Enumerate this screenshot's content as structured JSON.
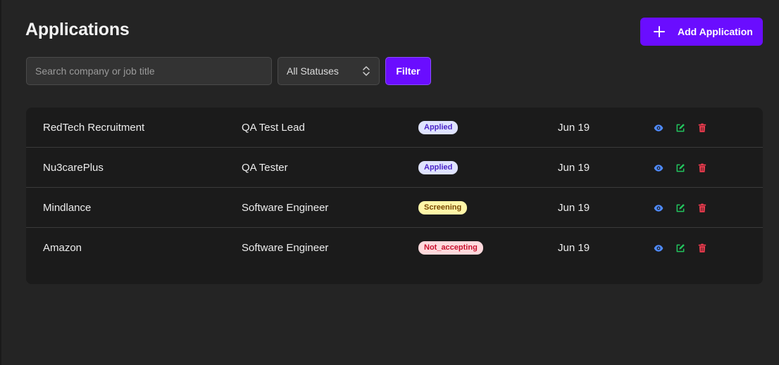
{
  "header": {
    "title": "Applications",
    "add_button_label": "Add Application"
  },
  "filters": {
    "search_placeholder": "Search company or job title",
    "search_value": "",
    "status_selected": "All Statuses",
    "filter_button_label": "Filter"
  },
  "colors": {
    "accent": "#6a0dff",
    "view_icon": "#4f8bff",
    "edit_icon": "#22c55e",
    "delete_icon": "#ef3b4e"
  },
  "badge_styles": {
    "Applied": {
      "bg": "#dfe3ff",
      "fg": "#4b25c8"
    },
    "Screening": {
      "bg": "#fff6a8",
      "fg": "#7a4a00"
    },
    "Not_accepting": {
      "bg": "#ffd9dc",
      "fg": "#c8102e"
    }
  },
  "applications": [
    {
      "company": "RedTech Recruitment",
      "job_title": "QA Test Lead",
      "status": "Applied",
      "date": "Jun 19"
    },
    {
      "company": "Nu3carePlus",
      "job_title": "QA Tester",
      "status": "Applied",
      "date": "Jun 19"
    },
    {
      "company": "Mindlance",
      "job_title": "Software Engineer",
      "status": "Screening",
      "date": "Jun 19"
    },
    {
      "company": "Amazon",
      "job_title": "Software Engineer",
      "status": "Not_accepting",
      "date": "Jun 19"
    }
  ],
  "row_actions": {
    "view_icon": "eye-icon",
    "edit_icon": "edit-icon",
    "delete_icon": "trash-icon"
  }
}
